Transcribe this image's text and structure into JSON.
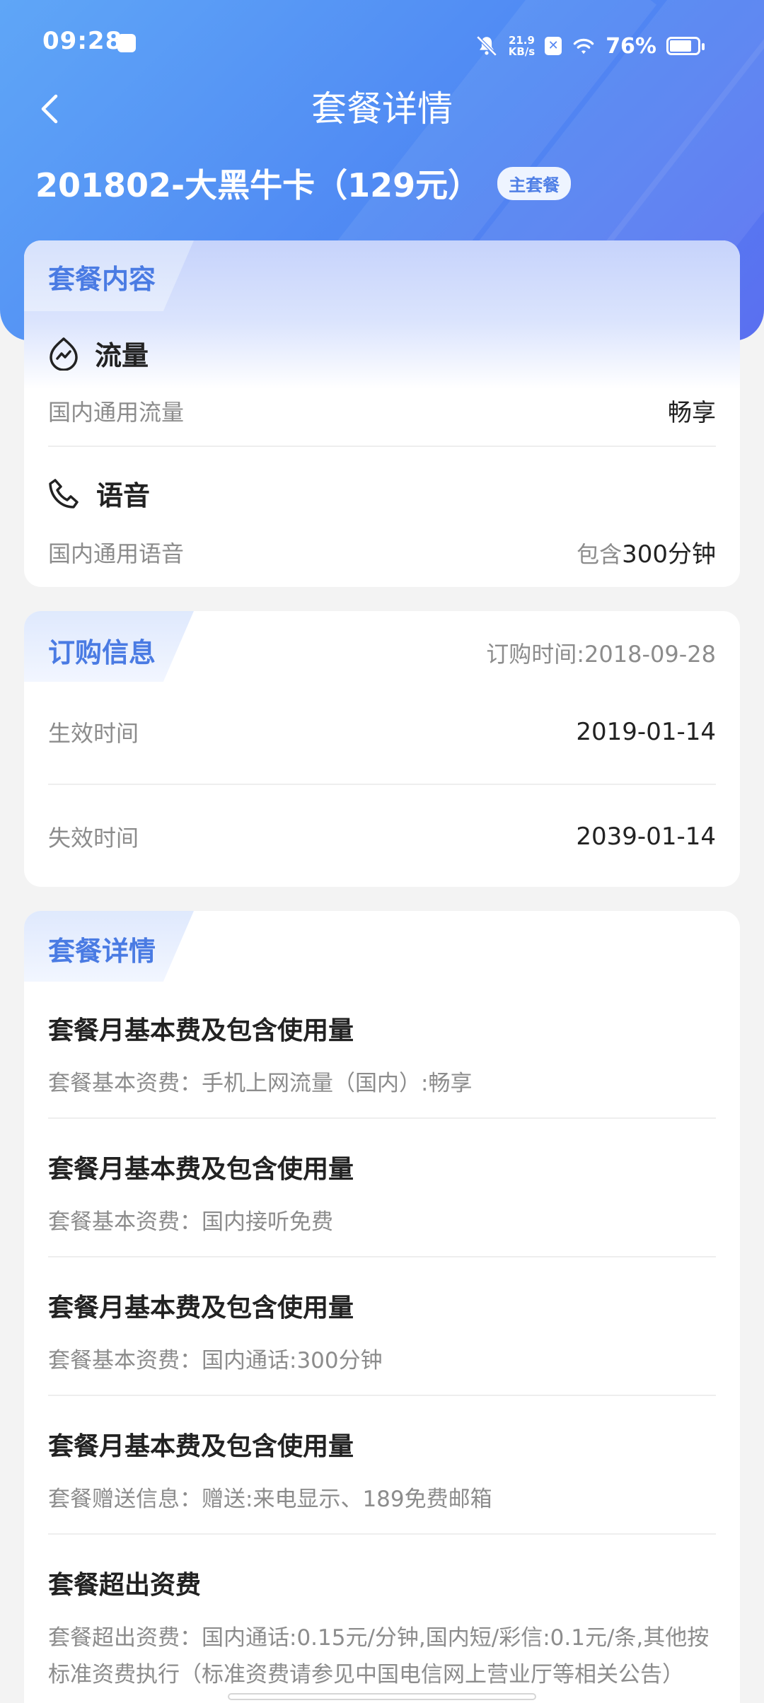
{
  "status_bar": {
    "time": "09:28",
    "net_speed_value": "21.9",
    "net_speed_unit": "KB/s",
    "x_badge": "✕",
    "battery": "76%"
  },
  "nav": {
    "title": "套餐详情"
  },
  "plan": {
    "name": "201802-大黑牛卡（129元）",
    "badge": "主套餐"
  },
  "package_content": {
    "tab_label": "套餐内容",
    "data": {
      "title": "流量",
      "item_label": "国内通用流量",
      "item_value": "畅享"
    },
    "voice": {
      "title": "语音",
      "item_label": "国内通用语音",
      "item_value_prefix": "包含",
      "item_value": "300分钟"
    }
  },
  "order_info": {
    "tab_label": "订购信息",
    "order_time": "订购时间:2018-09-28",
    "effective_label": "生效时间",
    "effective_value": "2019-01-14",
    "expire_label": "失效时间",
    "expire_value": "2039-01-14"
  },
  "package_details": {
    "tab_label": "套餐详情",
    "items": [
      {
        "title": "套餐月基本费及包含使用量",
        "desc": "套餐基本资费：手机上网流量（国内）:畅享"
      },
      {
        "title": "套餐月基本费及包含使用量",
        "desc": "套餐基本资费：国内接听免费"
      },
      {
        "title": "套餐月基本费及包含使用量",
        "desc": "套餐基本资费：国内通话:300分钟"
      },
      {
        "title": "套餐月基本费及包含使用量",
        "desc": "套餐赠送信息：赠送:来电显示、189免费邮箱"
      },
      {
        "title": "套餐超出资费",
        "desc": "套餐超出资费：国内通话:0.15元/分钟,国内短/彩信:0.1元/条,其他按标准资费执行（标准资费请参见中国电信网上营业厅等相关公告）"
      }
    ]
  },
  "colors": {
    "header_gradient_start": "#5fa6f7",
    "header_gradient_end": "#5b6ff0",
    "accent": "#4a7be3",
    "muted_text": "#8c8c8c"
  }
}
